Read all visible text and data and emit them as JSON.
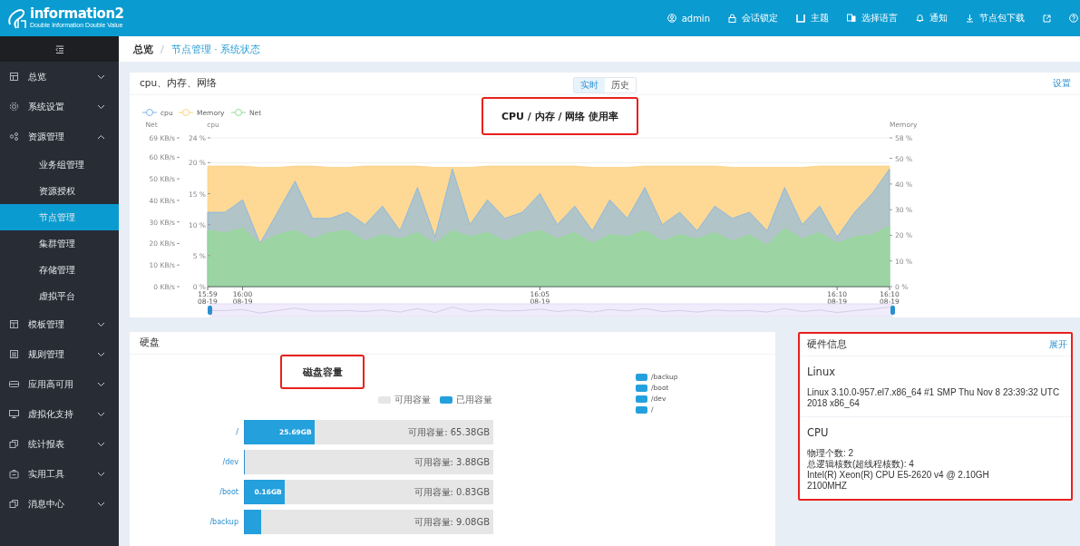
{
  "header": {
    "logo": {
      "name": "information2",
      "tagline": "Double Information Double Value"
    },
    "menu": [
      {
        "label": "admin"
      },
      {
        "label": "会话锁定"
      },
      {
        "label": "主题"
      },
      {
        "label": "选择语言"
      },
      {
        "label": "通知"
      },
      {
        "label": "节点包下载"
      }
    ]
  },
  "sidebar": {
    "items": [
      {
        "label": "总览",
        "selected": false,
        "expanded": false
      },
      {
        "label": "系统设置",
        "selected": false,
        "expanded": false
      },
      {
        "label": "资源管理",
        "selected": false,
        "expanded": true,
        "children": [
          {
            "label": "业务组管理",
            "selected": false
          },
          {
            "label": "资源授权",
            "selected": false
          },
          {
            "label": "节点管理",
            "selected": true
          },
          {
            "label": "集群管理",
            "selected": false
          },
          {
            "label": "存储管理",
            "selected": false
          },
          {
            "label": "虚拟平台",
            "selected": false
          }
        ]
      },
      {
        "label": "模板管理",
        "selected": false,
        "expanded": false
      },
      {
        "label": "规则管理",
        "selected": false,
        "expanded": false
      },
      {
        "label": "应用高可用",
        "selected": false,
        "expanded": false
      },
      {
        "label": "虚拟化支持",
        "selected": false,
        "expanded": false
      },
      {
        "label": "统计报表",
        "selected": false,
        "expanded": false
      },
      {
        "label": "实用工具",
        "selected": false,
        "expanded": false
      },
      {
        "label": "消息中心",
        "selected": false,
        "expanded": false
      }
    ]
  },
  "breadcrumb": {
    "root": "总览",
    "separator": "/",
    "current": "节点管理 · 系统状态"
  },
  "chart_panel": {
    "title": "cpu、内存、网络",
    "tabs": [
      {
        "label": "实时",
        "selected": true
      },
      {
        "label": "历史",
        "selected": false
      }
    ],
    "settings_link": "设置",
    "annotation": "CPU / 内存 / 网络 使用率",
    "chart_data": {
      "type": "area",
      "legend": "top-left",
      "categories": [
        "15:59\n08-19",
        null,
        "16:00\n08-19",
        null,
        null,
        null,
        null,
        null,
        null,
        null,
        null,
        null,
        null,
        null,
        null,
        null,
        null,
        null,
        null,
        "16:05\n08-19",
        null,
        null,
        null,
        null,
        null,
        null,
        null,
        null,
        null,
        null,
        null,
        null,
        null,
        null,
        null,
        null,
        "16:10\n08-19",
        null,
        null,
        "16:10\n08-19"
      ],
      "ylabel": "cpu",
      "ylim": [
        0,
        24
      ],
      "yticks": [
        {
          "value": 0,
          "label": "0 %"
        },
        {
          "value": 5,
          "label": "5 %"
        },
        {
          "value": 10,
          "label": "10 %"
        },
        {
          "value": 15,
          "label": "15 %"
        },
        {
          "value": 20,
          "label": "20 %"
        },
        {
          "value": 24,
          "label": "24 %"
        }
      ],
      "y2label": "Memory",
      "y2lim": [
        0,
        58
      ],
      "y2ticks": [
        {
          "value": 0,
          "label": "0 %"
        },
        {
          "value": 10,
          "label": "10 %"
        },
        {
          "value": 20,
          "label": "20 %"
        },
        {
          "value": 30,
          "label": "30 %"
        },
        {
          "value": 40,
          "label": "40 %"
        },
        {
          "value": 50,
          "label": "50 %"
        },
        {
          "value": 58,
          "label": "58 %"
        }
      ],
      "y3label": "Net",
      "y3lim": [
        0,
        69
      ],
      "y3ticks": [
        {
          "value": 0,
          "label": "0 KB/s"
        },
        {
          "value": 10,
          "label": "10 KB/s"
        },
        {
          "value": 20,
          "label": "20 KB/s"
        },
        {
          "value": 30,
          "label": "30 KB/s"
        },
        {
          "value": 40,
          "label": "40 KB/s"
        },
        {
          "value": 50,
          "label": "50 KB/s"
        },
        {
          "value": 60,
          "label": "60 KB/s"
        },
        {
          "value": 69,
          "label": "69 KB/s"
        }
      ],
      "series": [
        {
          "name": "cpu",
          "color": "#7eb5ea",
          "values": [
            12,
            12,
            14,
            7,
            12,
            17,
            11,
            11,
            12,
            10,
            13,
            9,
            16,
            8,
            19,
            10,
            14,
            11,
            12,
            15,
            10,
            13,
            9,
            14,
            11,
            16,
            10,
            12,
            9,
            13,
            11,
            12,
            9,
            16,
            10,
            13,
            8,
            12,
            15,
            19
          ]
        },
        {
          "name": "Memory",
          "color": "#fdd283",
          "axis": "y2",
          "values": [
            47,
            47,
            47,
            46.5,
            46.5,
            47,
            47,
            46.5,
            46.5,
            47,
            47,
            47,
            47,
            46.5,
            46.5,
            46.5,
            47,
            47,
            47,
            47,
            47,
            47,
            46.5,
            46.5,
            46.5,
            47,
            47,
            47,
            47,
            47,
            46.5,
            46.5,
            46.5,
            46.5,
            46.5,
            47,
            47,
            47,
            47,
            47
          ]
        },
        {
          "name": "Net",
          "color": "#8fe08c",
          "axis": "y3",
          "values": [
            26,
            25,
            27,
            20,
            24,
            26,
            22,
            25,
            26,
            21,
            24,
            22,
            25,
            20,
            26,
            23,
            25,
            21,
            24,
            26,
            22,
            25,
            20,
            24,
            23,
            26,
            21,
            24,
            22,
            25,
            21,
            24,
            19,
            27,
            22,
            25,
            20,
            23,
            24,
            28
          ]
        }
      ]
    }
  },
  "disk_panel": {
    "title": "硬盘",
    "annotation": "磁盘容量",
    "legend": [
      {
        "label": "可用容量",
        "kind": "free"
      },
      {
        "label": "已用容量",
        "kind": "used"
      }
    ],
    "disks": [
      {
        "name": "/",
        "used_label": "25.69GB",
        "free_label": "可用容量: 65.38GB",
        "level": 0.28
      },
      {
        "name": "/dev",
        "free_label": "可用容量: 3.88GB",
        "level": 0
      },
      {
        "name": "/boot",
        "used_label": "0.16GB",
        "free_label": "可用容量: 0.83GB",
        "level": 0.16
      },
      {
        "name": "/backup",
        "free_label": "可用容量: 9.08GB",
        "level": 0.065
      }
    ],
    "mount_legend": [
      "/backup",
      "/boot",
      "/dev",
      "/"
    ]
  },
  "hardware_panel": {
    "title": "硬件信息",
    "expand_link": "展开",
    "sections": [
      {
        "heading": "Linux",
        "lines": [
          "Linux 3.10.0-957.el7.x86_64 #1 SMP Thu Nov 8 23:39:32 UTC 2018 x86_64"
        ]
      },
      {
        "heading": "CPU",
        "lines": [
          "物理个数: 2",
          "总逻辑核数(超线程核数): 4",
          "Intel(R) Xeon(R) CPU E5-2620 v4 @ 2.10GH",
          "2100MHZ"
        ]
      }
    ]
  }
}
